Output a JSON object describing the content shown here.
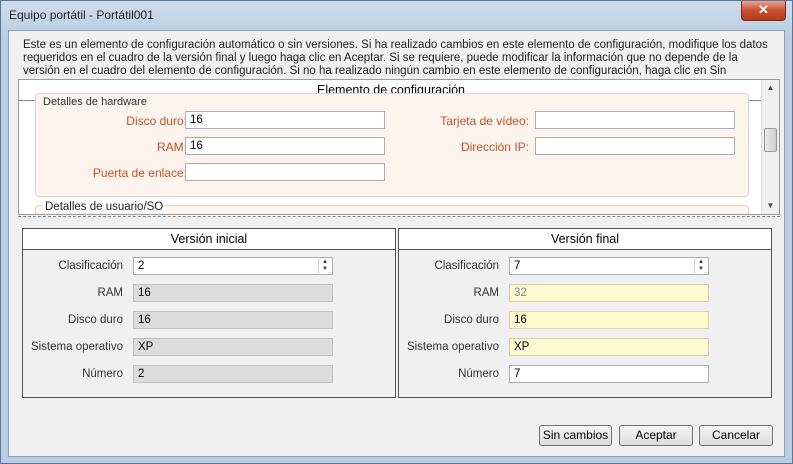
{
  "window": {
    "title": "Equipo portátil - Portátil001",
    "close_label": "✕"
  },
  "info_text": "Este es un elemento de configuración automático o sin versiones. Si ha realizado cambios en este elemento de configuración, modifique los datos requeridos en el cuadro de la versión final y luego haga clic en Aceptar. Si se requiere, puede modificar la información que no depende de la versión en el cuadro del elemento de configuración. Si no ha realizado ningún cambio en este elemento de configuración, haga clic en Sin cambios.",
  "config_item": {
    "header": "Elemento de configuración",
    "hardware_legend": "Detalles de hardware",
    "user_legend": "Detalles de usuario/SO",
    "fields": {
      "disk_label": "Disco duro:",
      "disk_value": "16",
      "ram_label": "RAM:",
      "ram_value": "16",
      "gateway_label": "Puerta de enlace:",
      "gateway_value": "",
      "video_label": "Tarjeta de vídeo:",
      "video_value": "",
      "ip_label": "Dirección IP:",
      "ip_value": ""
    }
  },
  "initial_version": {
    "header": "Versión inicial",
    "classification_label": "Clasificación",
    "classification_value": "2",
    "ram_label": "RAM",
    "ram_value": "16",
    "disk_label": "Disco duro",
    "disk_value": "16",
    "os_label": "Sistema operativo",
    "os_value": "XP",
    "number_label": "Número",
    "number_value": "2"
  },
  "final_version": {
    "header": "Versión final",
    "classification_label": "Clasificación",
    "classification_value": "7",
    "ram_label": "RAM",
    "ram_value": "32",
    "disk_label": "Disco duro",
    "disk_value": "16",
    "os_label": "Sistema operativo",
    "os_value": "XP",
    "number_label": "Número",
    "number_value": "7"
  },
  "buttons": {
    "no_changes": "Sin cambios",
    "accept": "Aceptar",
    "cancel": "Cancelar"
  },
  "colors": {
    "label_orange": "#c5502a",
    "changed_field": "#fff9cf",
    "readonly_field": "#dcdcdc"
  }
}
